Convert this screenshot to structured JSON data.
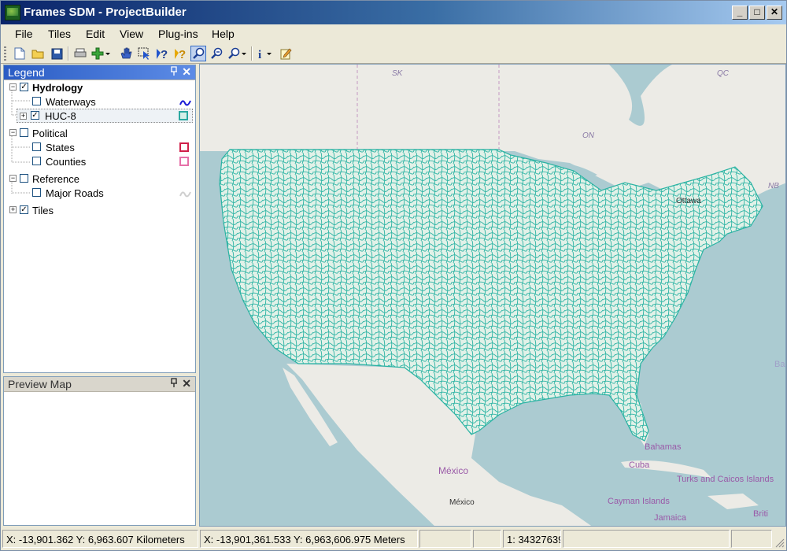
{
  "window": {
    "title": "Frames SDM  - ProjectBuilder",
    "min": "_",
    "max": "□",
    "close": "✕"
  },
  "menu": [
    "File",
    "Tiles",
    "Edit",
    "View",
    "Plug-ins",
    "Help"
  ],
  "toolbar_icons": [
    "new-document-icon",
    "open-folder-icon",
    "save-icon",
    "print-icon",
    "add-layer-icon",
    "pan-hand-icon",
    "select-arrow-icon",
    "help-question-icon",
    "identify-question-icon",
    "zoom-in-icon",
    "zoom-out-icon",
    "zoom-dropdown-icon",
    "info-icon",
    "edit-note-icon"
  ],
  "legend": {
    "title": "Legend",
    "pin": "📌",
    "close": "✕",
    "groups": {
      "hydrology": {
        "label": "Hydrology",
        "checked": true
      },
      "waterways": {
        "label": "Waterways",
        "checked": false,
        "color": "#1a1ad6"
      },
      "huc8": {
        "label": "HUC-8",
        "checked": true,
        "color": "#2aa8a0"
      },
      "political": {
        "label": "Political",
        "checked": false
      },
      "states": {
        "label": "States",
        "checked": false,
        "color": "#d0204a"
      },
      "counties": {
        "label": "Counties",
        "checked": false,
        "color": "#e670a8"
      },
      "reference": {
        "label": "Reference",
        "checked": false
      },
      "roads": {
        "label": "Major Roads",
        "checked": false,
        "color": "#cfcfcf"
      },
      "tiles": {
        "label": "Tiles",
        "checked": true
      }
    }
  },
  "preview": {
    "title": "Preview Map",
    "pin": "📌",
    "close": "✕"
  },
  "map_labels": {
    "sk": "SK",
    "qc": "QC",
    "on": "ON",
    "nb": "NB",
    "ottawa": "Ottawa",
    "ba": "Ba",
    "bahamas": "Bahamas",
    "cuba": "Cuba",
    "mexico_country": "México",
    "mexico_city": "México",
    "turks": "Turks and Caicos Islands",
    "cayman": "Cayman Islands",
    "jamaica": "Jamaica",
    "british": "Briti"
  },
  "status": {
    "km": "X: -13,901.362 Y: 6,963.607 Kilometers",
    "m": "X: -13,901,361.533 Y: 6,963,606.975 Meters",
    "scale": "1: 34327639"
  }
}
